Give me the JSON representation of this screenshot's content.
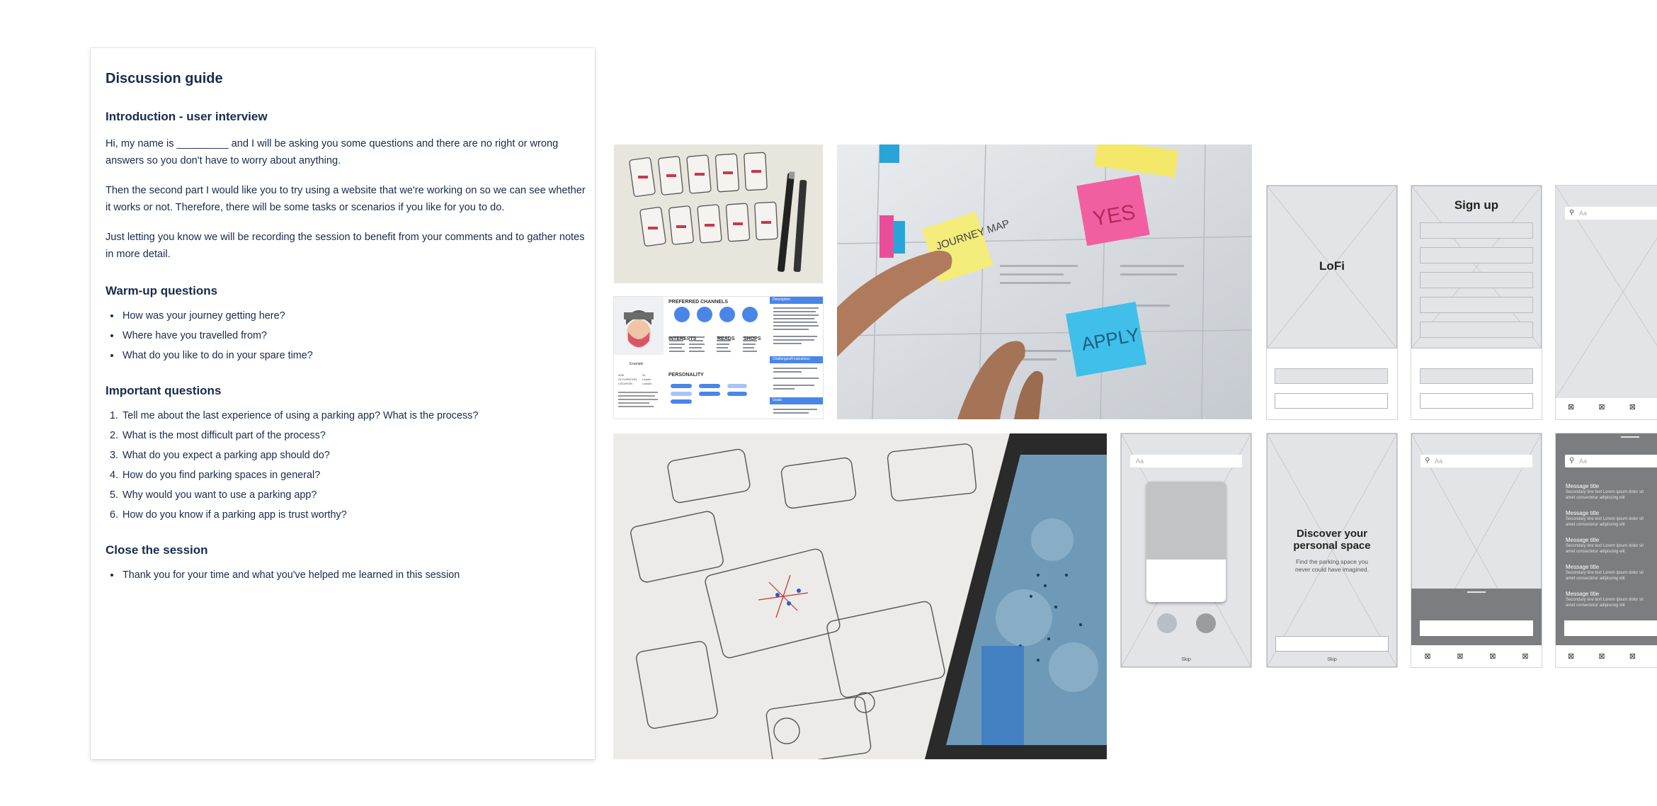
{
  "doc": {
    "title": "Discussion guide",
    "intro_heading": "Introduction - user interview",
    "intro_p1": "Hi, my name is _________ and I will be asking you some questions and there are no right or wrong answers so you don't have to worry about anything.",
    "intro_p2": "Then the second part I would like you to try using a website that we're working on so we can see whether it works or not. Therefore, there will be some tasks or scenarios if you like for you to do.",
    "intro_p3": "Just letting you know we will be recording the session to benefit from your comments and to gather notes in more detail.",
    "warmup_heading": "Warm-up questions",
    "warmup": [
      "How was your journey getting here?",
      "Where have you travelled from?",
      "What do you like to do in your spare time?"
    ],
    "important_heading": "Important questions",
    "important": [
      "Tell me about the last experience of using a parking app? What is the process?",
      "What is the most difficult part of the process?",
      "What do you expect a parking app should do?",
      "How do you find parking spaces in general?",
      "Why would you want to use a parking app?",
      "How do you know if a parking app is trust worthy?"
    ],
    "close_heading": "Close the session",
    "close": [
      "Thank you for your time and what you've helped me learned in this session"
    ]
  },
  "persona": {
    "channels_heading": "PREFERRED CHANNELS",
    "interests_heading": "INTERESTS",
    "reads_heading": "READS",
    "shops_heading": "SHOPS",
    "personality_heading": "PERSONALITY",
    "name": "Example",
    "side_heading1": "Description",
    "side_heading2": "Challenges/Frustrations",
    "side_heading3": "Goals",
    "accent": "#4a86e8"
  },
  "stickies": {
    "note1": "JOURNEY MAP",
    "note2": "YES",
    "note3": "APPLY"
  },
  "wireframes": {
    "lofi_title": "LoFi",
    "signup_title": "Sign up",
    "search_placeholder": "Aa",
    "discover_title": "Discover your personal space",
    "discover_sub": "Find the parking space you never could have imagined.",
    "skip": "Skip",
    "message_title": "Message title",
    "message_body": "Secondary line text Lorem ipsum dolor sit amet consectetur adipiscing elit",
    "icon_glyph": "⊠"
  }
}
